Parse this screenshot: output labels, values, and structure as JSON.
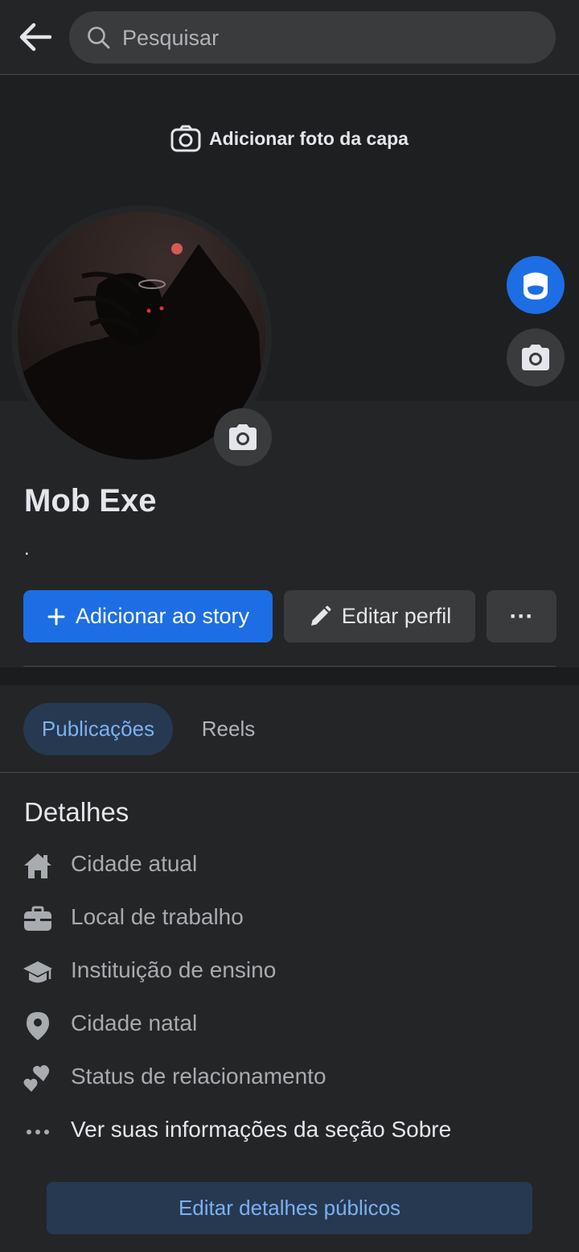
{
  "search": {
    "placeholder": "Pesquisar"
  },
  "cover": {
    "add_cover_label": "Adicionar foto da capa"
  },
  "profile": {
    "name": "Mob Exe",
    "bio": "."
  },
  "actions": {
    "add_story_label": "Adicionar ao story",
    "edit_profile_label": "Editar perfil",
    "more_label": "···"
  },
  "tabs": [
    {
      "label": "Publicações",
      "active": true
    },
    {
      "label": "Reels",
      "active": false
    }
  ],
  "details": {
    "title": "Detalhes",
    "items": [
      {
        "icon": "home-icon",
        "label": "Cidade atual"
      },
      {
        "icon": "briefcase-icon",
        "label": "Local de trabalho"
      },
      {
        "icon": "graduation-cap-icon",
        "label": "Instituição de ensino"
      },
      {
        "icon": "location-pin-icon",
        "label": "Cidade natal"
      },
      {
        "icon": "hearts-icon",
        "label": "Status de relacionamento"
      },
      {
        "icon": "more-dots-icon",
        "label": "Ver suas informações da seção Sobre"
      }
    ],
    "edit_public_label": "Editar detalhes públicos"
  },
  "colors": {
    "background": "#242527",
    "cover": "#1e1f21",
    "primary": "#1d6ee4",
    "tab_active_bg": "#263951",
    "tab_active_text": "#7cb0f0"
  }
}
